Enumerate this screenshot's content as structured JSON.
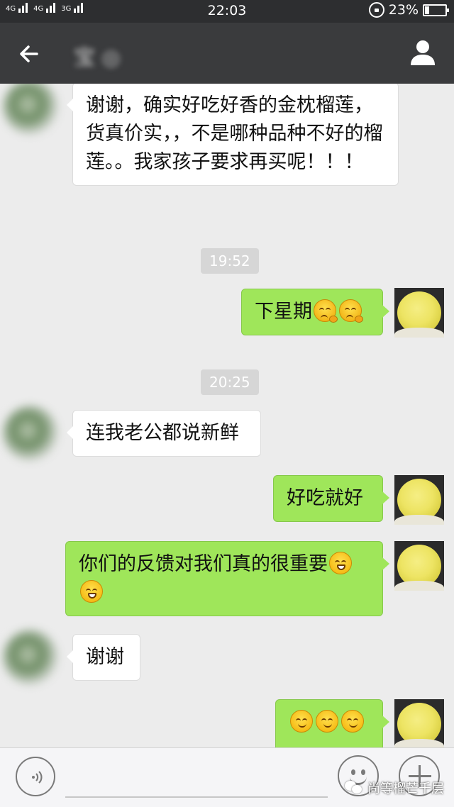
{
  "status_bar": {
    "network_1": "4G",
    "network_2": "4G",
    "network_3": "3G",
    "time": "22:03",
    "battery": "23%",
    "battery_level": 0.23
  },
  "nav": {
    "title": "宝 ◎"
  },
  "messages": [
    {
      "direction": "in",
      "text": "谢谢，确实好吃好香的金枕榴莲，货真价实，，不是哪种品种不好的榴莲。。我家孩子要求再买呢！！！"
    },
    {
      "timestamp": "19:52"
    },
    {
      "direction": "out",
      "text": "下星期",
      "emoji": [
        "thinking-face-icon",
        "thinking-face-icon"
      ]
    },
    {
      "timestamp": "20:25"
    },
    {
      "direction": "in",
      "text": "连我老公都说新鲜"
    },
    {
      "direction": "out",
      "text": "好吃就好"
    },
    {
      "direction": "out",
      "text": "你们的反馈对我们真的很重要",
      "emoji": [
        "grinning-face-icon",
        "grinning-face-icon"
      ]
    },
    {
      "direction": "in",
      "text": "谢谢"
    },
    {
      "direction": "out",
      "text": "",
      "emoji": [
        "smiling-face-icon",
        "smiling-face-icon",
        "smiling-face-icon"
      ]
    }
  ],
  "input_bar": {
    "text_value": "",
    "icons": [
      "voice-icon",
      "emoji-icon",
      "plus-icon"
    ]
  },
  "watermark": {
    "text": "尚等榴芒千层"
  },
  "colors": {
    "outgoing_bubble": "#9fe65a",
    "incoming_bubble": "#ffffff",
    "chat_background": "#ececec",
    "nav_background": "#3a3b3d"
  }
}
